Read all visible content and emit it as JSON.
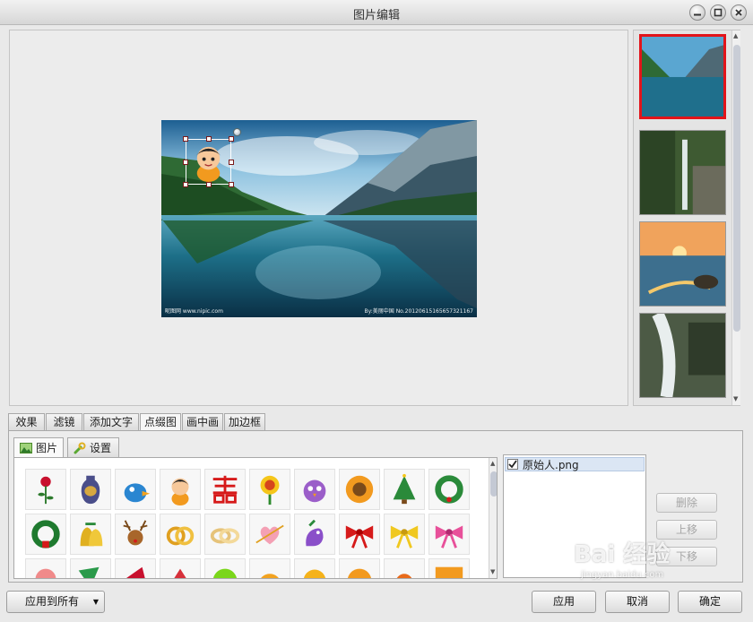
{
  "window": {
    "title": "图片编辑"
  },
  "main_photo": {
    "watermark_left": "昵图网 www.nipic.com",
    "watermark_right": "By:美丽中国 No.20120615165657321167"
  },
  "thumbnails": [
    {
      "name": "lake-mountains",
      "selected": true
    },
    {
      "name": "waterfall"
    },
    {
      "name": "sunset-beach"
    },
    {
      "name": "stream"
    }
  ],
  "tabs": [
    "效果",
    "滤镜",
    "添加文字",
    "点缀图",
    "画中画",
    "加边框"
  ],
  "active_tab": "点缀图",
  "subtabs": [
    {
      "label": "图片",
      "icon": "image-icon"
    },
    {
      "label": "设置",
      "icon": "wrench-icon"
    }
  ],
  "stickers": [
    "rose",
    "vase",
    "blue-bird",
    "caveman",
    "double-happiness",
    "flower",
    "purple-bird",
    "sunflower",
    "christmas-tree",
    "wreath",
    "wreath",
    "bells",
    "reindeer",
    "gold-rings",
    "silver-rings",
    "heart-arrow",
    "purple-dragon",
    "red-bow",
    "yellow-bow",
    "pink-bow",
    "pink-hearts",
    "green-leaves",
    "red-shapes",
    "red-crane",
    "green-sun",
    "orange-chick",
    "yellow-lion",
    "orange-slice",
    "orange-sun",
    "orange-box"
  ],
  "layers": [
    {
      "label": "原始人.png",
      "checked": true
    }
  ],
  "layer_buttons": {
    "delete": "删除",
    "up": "上移",
    "down": "下移"
  },
  "bottom": {
    "apply_all": "应用到所有",
    "apply": "应用",
    "cancel": "取消",
    "ok": "确定"
  },
  "watermark": {
    "brand": "Bai 经验",
    "url": "jingyan.baidu.com"
  },
  "colors": {
    "accent_selected": "#e2141a",
    "window_bg": "#e9e9e9"
  }
}
